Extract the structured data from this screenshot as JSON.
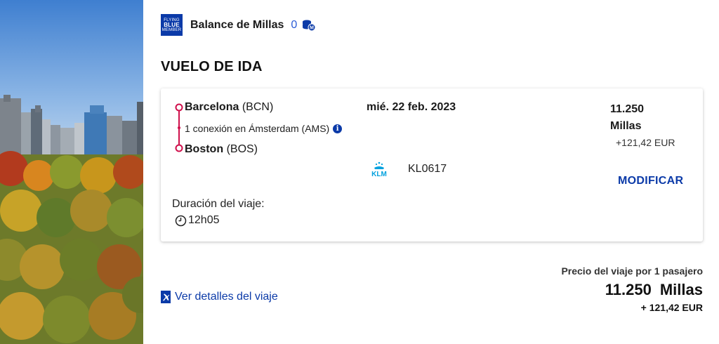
{
  "colors": {
    "brand_blue": "#0b3aa8",
    "accent_blue": "#2b5cd6",
    "route_red": "#d0104c"
  },
  "balance": {
    "logo_line1": "FLYING",
    "logo_line2": "BLUE",
    "logo_line3": "MEMBER",
    "label": "Balance de Millas",
    "value": "0",
    "icon": "miles-coins-icon"
  },
  "section_title": "VUELO DE IDA",
  "flight": {
    "origin_city": "Barcelona",
    "origin_code": "(BCN)",
    "connection": "1 conexión en Ámsterdam (AMS)",
    "destination_city": "Boston",
    "destination_code": "(BOS)",
    "date": "mié. 22 feb. 2023",
    "airline_logo": "KLM",
    "flight_number": "KL0617",
    "price_miles_amount": "11.250",
    "price_miles_unit": "Millas",
    "price_eur": "+121,42 EUR",
    "modify_label": "MODIFICAR",
    "duration_label": "Duración del viaje:",
    "duration_value": "12h05"
  },
  "footer": {
    "details_link": "Ver detalles del viaje",
    "total_label": "Precio del viaje por 1 pasajero",
    "total_miles_amount": "11.250",
    "total_miles_unit": "Millas",
    "total_eur": "+ 121,42 EUR"
  }
}
